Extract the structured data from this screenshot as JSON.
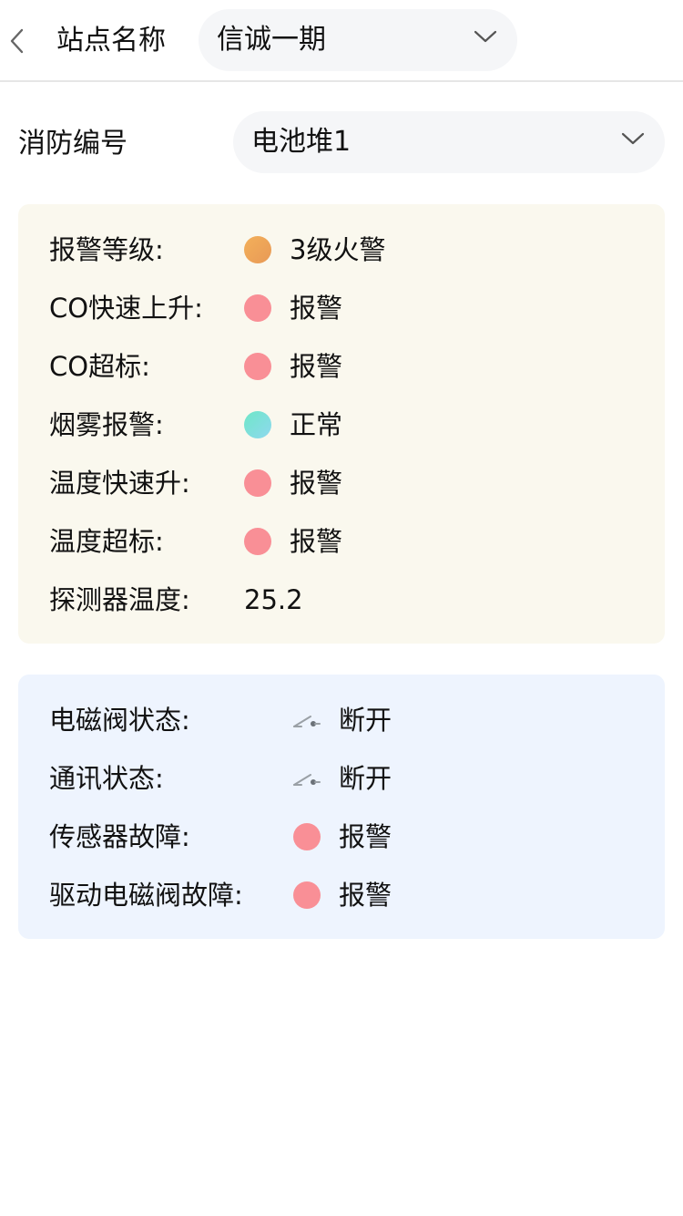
{
  "header": {
    "site_label": "站点名称",
    "site_value": "信诚一期"
  },
  "fire": {
    "label": "消防编号",
    "value": "电池堆1"
  },
  "alarm_card": {
    "rows": [
      {
        "label": "报警等级:",
        "value": "3级火警",
        "indicator": "orange-dot",
        "color": "#ee9f58"
      },
      {
        "label": "CO快速上升:",
        "value": "报警",
        "indicator": "red-dot",
        "color": "#f98f96"
      },
      {
        "label": "CO超标:",
        "value": "报警",
        "indicator": "red-dot",
        "color": "#f98f96"
      },
      {
        "label": "烟雾报警:",
        "value": "正常",
        "indicator": "green-dot",
        "color": "#7fe1d8"
      },
      {
        "label": "温度快速升:",
        "value": "报警",
        "indicator": "red-dot",
        "color": "#f98f96"
      },
      {
        "label": "温度超标:",
        "value": "报警",
        "indicator": "red-dot",
        "color": "#f98f96"
      },
      {
        "label": "探测器温度:",
        "value": "25.2"
      }
    ]
  },
  "valve_card": {
    "rows": [
      {
        "label": "电磁阀状态:",
        "value": "断开",
        "indicator": "switch-open-icon"
      },
      {
        "label": "通讯状态:",
        "value": "断开",
        "indicator": "switch-open-icon"
      },
      {
        "label": "传感器故障:",
        "value": "报警",
        "indicator": "red-dot",
        "color": "#f98f96"
      },
      {
        "label": "驱动电磁阀故障:",
        "value": "报警",
        "indicator": "red-dot",
        "color": "#f98f96"
      }
    ]
  }
}
